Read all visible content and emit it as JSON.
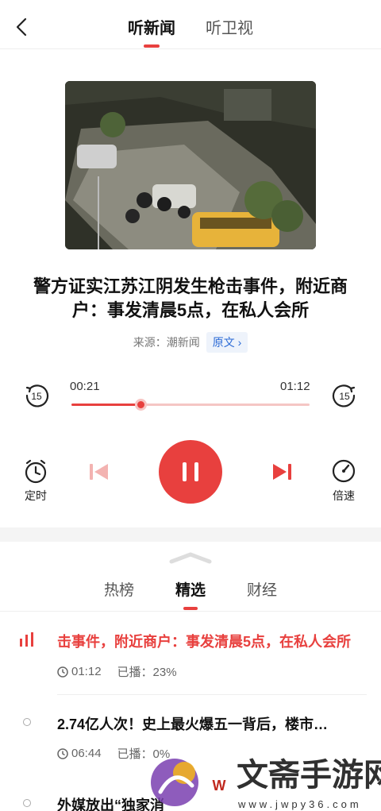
{
  "header": {
    "tabs": [
      {
        "label": "听新闻",
        "active": true
      },
      {
        "label": "听卫视",
        "active": false
      }
    ]
  },
  "article": {
    "title": "警方证实江苏江阴发生枪击事件，附近商户：事发清晨5点，在私人会所",
    "source_label": "来源：潮新闻",
    "original_button": "原文 ›"
  },
  "player": {
    "current_time": "00:21",
    "total_time": "01:12",
    "progress": 0.29,
    "skip_back_label": "15",
    "skip_forward_label": "15",
    "timer_label": "定时",
    "speed_label": "倍速",
    "accent_color": "#e8403e"
  },
  "list": {
    "tabs": [
      {
        "label": "热榜",
        "active": false
      },
      {
        "label": "精选",
        "active": true
      },
      {
        "label": "财经",
        "active": false
      }
    ],
    "items": [
      {
        "title": "击事件，附近商户：事发清晨5点，在私人会所",
        "duration": "01:12",
        "played": "已播：23%",
        "playing": true
      },
      {
        "title": "2.74亿人次！史上最火爆五一背后，楼市…",
        "duration": "06:44",
        "played": "已播：0%",
        "playing": false
      },
      {
        "title": "外媒放出“独家消",
        "playing": false
      }
    ]
  },
  "watermark": {
    "text": "文斋手游网",
    "url": "www.jwpy36.com"
  }
}
